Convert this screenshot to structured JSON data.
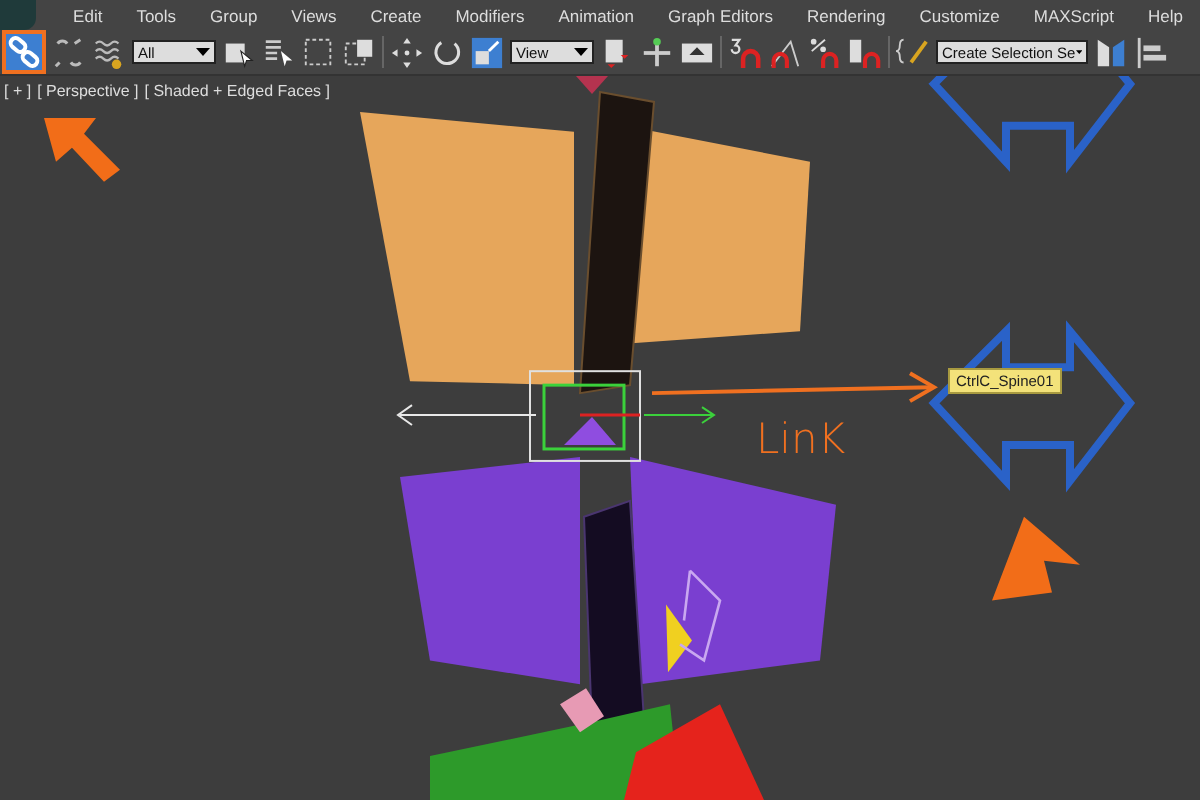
{
  "menu": [
    "Edit",
    "Tools",
    "Group",
    "Views",
    "Create",
    "Modifiers",
    "Animation",
    "Graph Editors",
    "Rendering",
    "Customize",
    "MAXScript",
    "Help"
  ],
  "toolbar": {
    "link_button": {
      "selected": true
    },
    "selection_filter": "All",
    "reference_coordinate": "View",
    "named_selection": "Create Selection Se"
  },
  "viewport": {
    "labels": [
      "[ + ]",
      "[ Perspective ]",
      "[ Shaded + Edged Faces ]"
    ],
    "tooltip": "CtrlC_Spine01",
    "annotation": "LinK"
  }
}
